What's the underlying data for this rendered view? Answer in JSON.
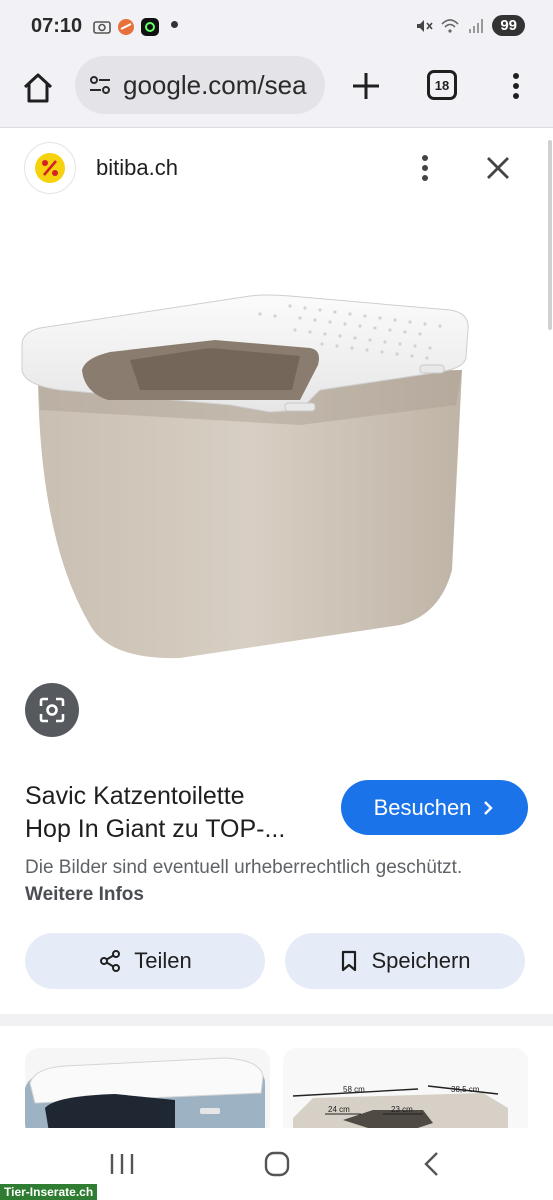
{
  "status_bar": {
    "time": "07:10",
    "battery": "99",
    "icons": [
      "camera-icon",
      "app-icon",
      "app-icon",
      "mute-icon",
      "wifi-icon",
      "signal-icon"
    ]
  },
  "browser": {
    "url": "google.com/sea",
    "tab_count": "18"
  },
  "panel": {
    "site_name": "bitiba.ch",
    "title_line1": "Savic Katzentoilette",
    "title_line2": "Hop In Giant zu TOP-...",
    "visit_label": "Besuchen",
    "copyright_text": "Die Bilder sind eventuell urheberrechtlich geschützt.",
    "more_info_label": "Weitere Infos",
    "share_label": "Teilen",
    "save_label": "Speichern"
  },
  "thumbnails": {
    "dim_labels": [
      "58 cm",
      "38,5 cm",
      "24 cm",
      "23 cm"
    ]
  },
  "watermark": "Tier-Inserate.ch",
  "colors": {
    "accent": "#1a73e8",
    "pill_bg": "#e6ecf7",
    "chrome_bg": "#f2f2f6"
  }
}
